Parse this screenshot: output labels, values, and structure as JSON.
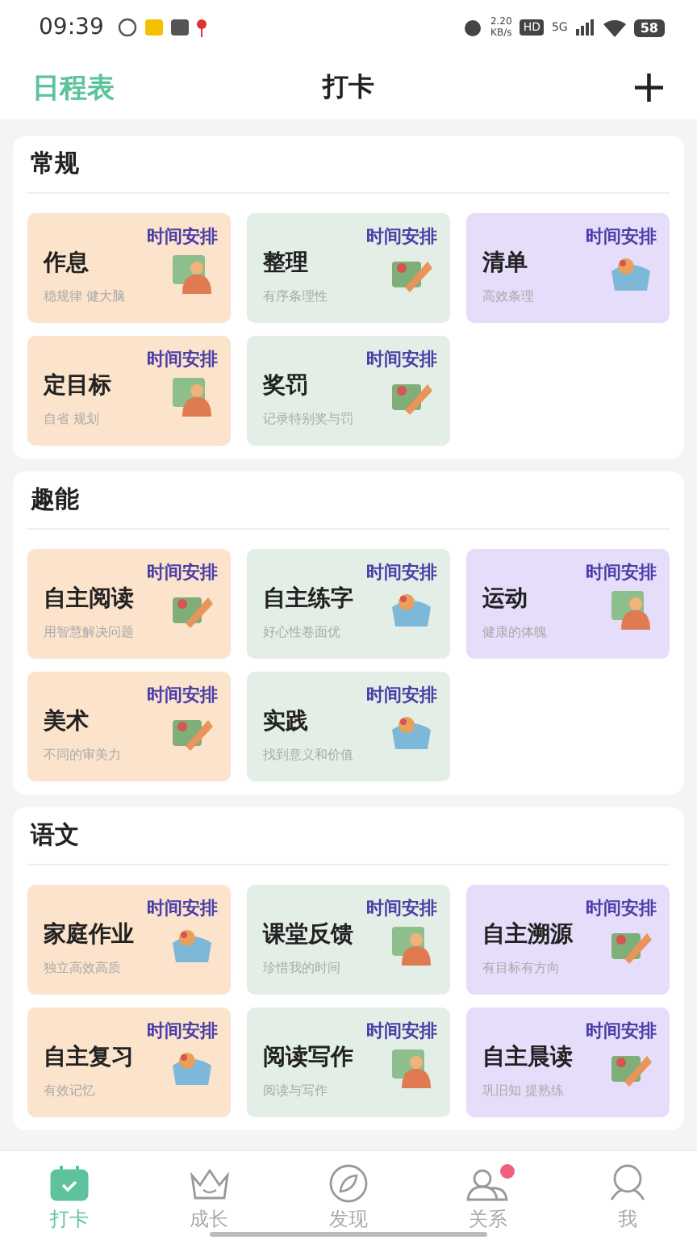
{
  "status_bar": {
    "time": "09:39",
    "speed": "2.20",
    "speed_unit": "KB/s",
    "hd": "HD",
    "network": "5G",
    "battery": "58"
  },
  "header": {
    "left": "日程表",
    "title": "打卡",
    "add": "+"
  },
  "sections": [
    {
      "title": "常规",
      "tiles": [
        {
          "name": "作息",
          "desc": "稳规律 健大脑",
          "tag": "时间安排",
          "color": "#fbe3cc"
        },
        {
          "name": "整理",
          "desc": "有序条理性",
          "tag": "时间安排",
          "color": "#e3eee6"
        },
        {
          "name": "清单",
          "desc": "高效条理",
          "tag": "时间安排",
          "color": "#e6ddfb"
        },
        {
          "name": "定目标",
          "desc": "自省 规划",
          "tag": "时间安排",
          "color": "#fbe3cc"
        },
        {
          "name": "奖罚",
          "desc": "记录特别奖与罚",
          "tag": "时间安排",
          "color": "#e3eee6"
        }
      ]
    },
    {
      "title": "趣能",
      "tiles": [
        {
          "name": "自主阅读",
          "desc": "用智慧解决问题",
          "tag": "时间安排",
          "color": "#fbe3cc"
        },
        {
          "name": "自主练字",
          "desc": "好心性卷面优",
          "tag": "时间安排",
          "color": "#e3eee6"
        },
        {
          "name": "运动",
          "desc": "健康的体魄",
          "tag": "时间安排",
          "color": "#e6ddfb"
        },
        {
          "name": "美术",
          "desc": "不同的审美力",
          "tag": "时间安排",
          "color": "#fbe3cc"
        },
        {
          "name": "实践",
          "desc": "找到意义和价值",
          "tag": "时间安排",
          "color": "#e3eee6"
        }
      ]
    },
    {
      "title": "语文",
      "tiles": [
        {
          "name": "家庭作业",
          "desc": "独立高效高质",
          "tag": "时间安排",
          "color": "#fbe3cc"
        },
        {
          "name": "课堂反馈",
          "desc": "珍惜我的时间",
          "tag": "时间安排",
          "color": "#e3eee6"
        },
        {
          "name": "自主溯源",
          "desc": "有目标有方向",
          "tag": "时间安排",
          "color": "#e6ddfb"
        },
        {
          "name": "自主复习",
          "desc": "有效记忆",
          "tag": "时间安排",
          "color": "#fbe3cc"
        },
        {
          "name": "阅读写作",
          "desc": "阅读与写作",
          "tag": "时间安排",
          "color": "#e3eee6"
        },
        {
          "name": "自主晨读",
          "desc": "巩旧知 提熟练",
          "tag": "时间安排",
          "color": "#e6ddfb"
        }
      ]
    }
  ],
  "tabs": [
    {
      "label": "打卡",
      "selected": true,
      "badge": false
    },
    {
      "label": "成长",
      "selected": false,
      "badge": false
    },
    {
      "label": "发现",
      "selected": false,
      "badge": false
    },
    {
      "label": "关系",
      "selected": false,
      "badge": true
    },
    {
      "label": "我",
      "selected": false,
      "badge": false
    }
  ]
}
